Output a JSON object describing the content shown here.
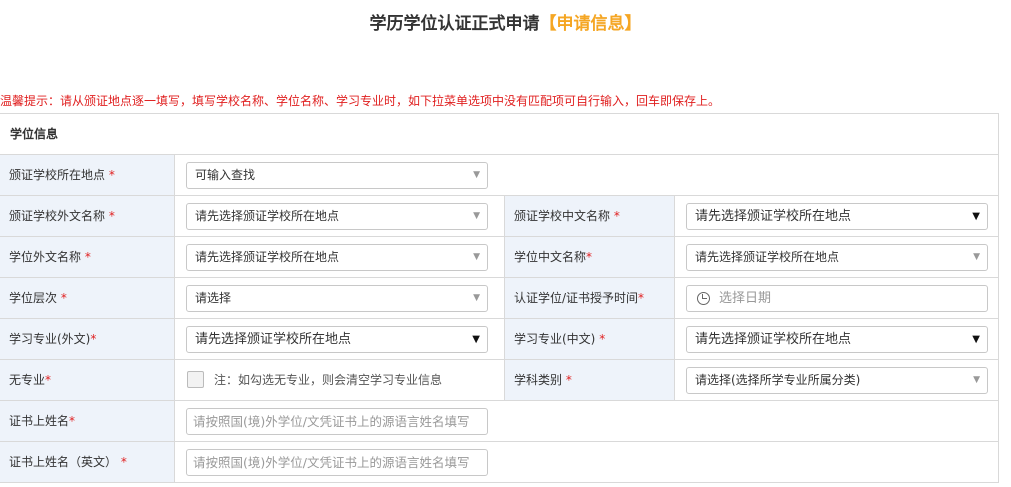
{
  "header": {
    "title": "学历学位认证正式申请",
    "subtitle": "【申请信息】"
  },
  "tip": "温馨提示：请从颁证地点逐一填写，填写学校名称、学位名称、学习专业时，如下拉菜单选项中没有匹配项可自行输入，回车即保存上。",
  "section_title": "学位信息",
  "fields": {
    "school_location": {
      "label": "颁证学校所在地点",
      "value": "可输入查找"
    },
    "school_foreign_name": {
      "label": "颁证学校外文名称",
      "value": "请先选择颁证学校所在地点"
    },
    "school_cn_name": {
      "label": "颁证学校中文名称",
      "value": "请先选择颁证学校所在地点"
    },
    "degree_foreign_name": {
      "label": "学位外文名称",
      "value": "请先选择颁证学校所在地点"
    },
    "degree_cn_name": {
      "label": "学位中文名称",
      "value": "请先选择颁证学校所在地点"
    },
    "degree_level": {
      "label": "学位层次",
      "value": "请选择"
    },
    "award_date": {
      "label": "认证学位/证书授予时间",
      "placeholder": "选择日期"
    },
    "major_foreign": {
      "label": "学习专业(外文)",
      "value": "请先选择颁证学校所在地点"
    },
    "major_cn": {
      "label": "学习专业(中文)",
      "value": "请先选择颁证学校所在地点"
    },
    "no_major": {
      "label": "无专业",
      "note": "注：如勾选无专业，则会清空学习专业信息",
      "checked": false
    },
    "subject_category": {
      "label": "学科类别",
      "value": "请选择(选择所学专业所属分类)"
    },
    "cert_name": {
      "label": "证书上姓名",
      "placeholder": "请按照国(境)外学位/文凭证书上的源语言姓名填写"
    },
    "cert_name_en": {
      "label": "证书上姓名（英文）",
      "placeholder": "请按照国(境)外学位/文凭证书上的源语言姓名填写"
    }
  },
  "required_mark": "*"
}
